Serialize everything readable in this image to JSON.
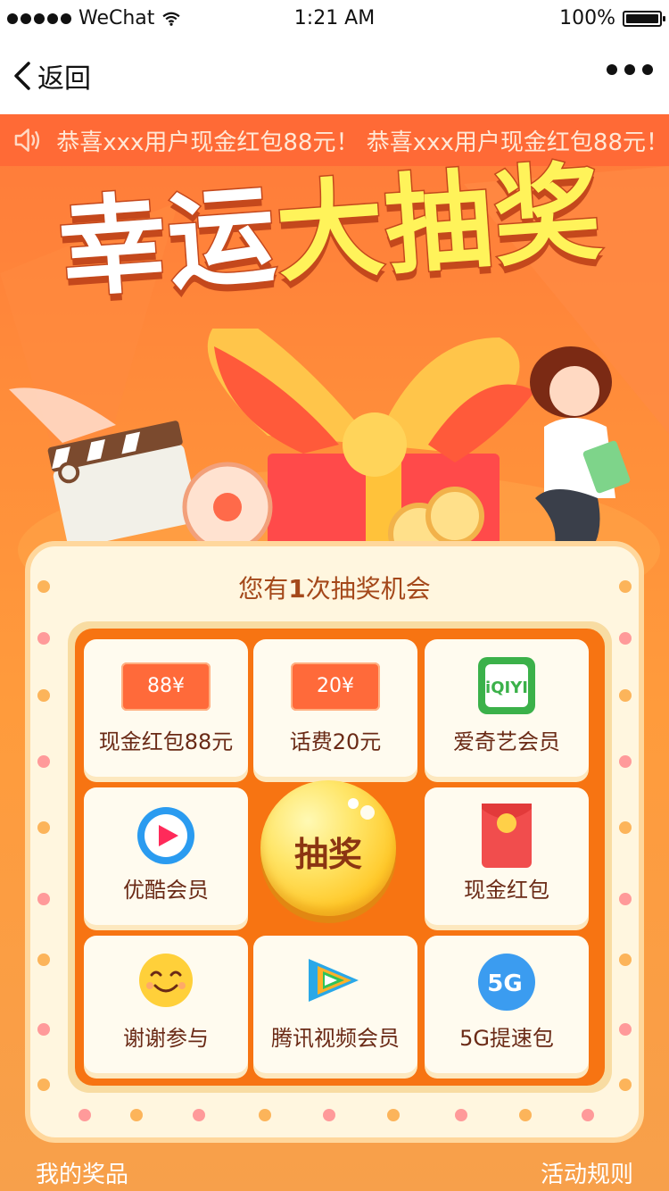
{
  "status": {
    "carrier": "WeChat",
    "time": "1:21 AM",
    "battery": "100%"
  },
  "navbar": {
    "back_label": "返回"
  },
  "ticker": {
    "text": "恭喜xxx用户现金红包88元！ 恭喜xxx用户现金红包88元！"
  },
  "hero": {
    "title_white": "幸运",
    "title_yellow": "大抽奖"
  },
  "lottery": {
    "heading_prefix": "您有",
    "chances": "1",
    "heading_suffix": "次抽奖机会",
    "draw_label": "抽奖",
    "prizes": [
      {
        "label": "现金红包88元",
        "coupon": "88¥",
        "icon": "coupon-icon"
      },
      {
        "label": "话费20元",
        "coupon": "20¥",
        "icon": "coupon-icon"
      },
      {
        "label": "爱奇艺会员",
        "icon": "iqiyi-icon",
        "logo_text": "iQIYI"
      },
      {
        "label": "优酷会员",
        "icon": "youku-icon"
      },
      {
        "label": "现金红包",
        "icon": "red-packet-icon"
      },
      {
        "label": "谢谢参与",
        "icon": "smiley-icon"
      },
      {
        "label": "腾讯视频会员",
        "icon": "tencent-video-icon"
      },
      {
        "label": "5G提速包",
        "icon": "5g-icon",
        "logo_text": "5G"
      }
    ]
  },
  "footer": {
    "left": "我的奖品",
    "right": "活动规则"
  },
  "colors": {
    "accent": "#ff7a3a",
    "grid": "#f77412",
    "cell": "#fffbef",
    "text": "#6a2a16"
  }
}
